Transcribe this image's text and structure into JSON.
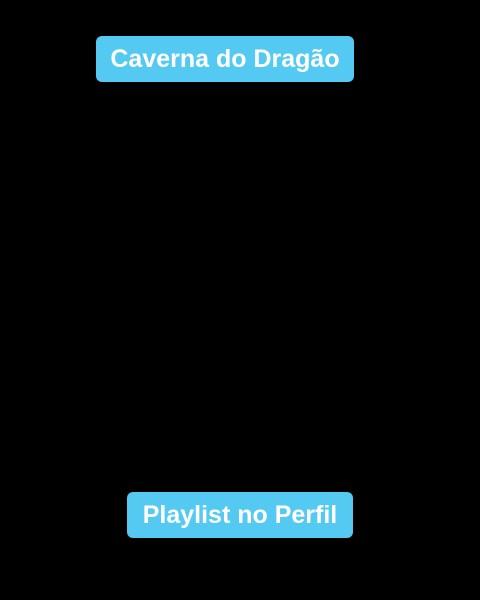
{
  "title_label": "Caverna do Dragão",
  "subtitle_label": "Playlist no Perfil",
  "colors": {
    "background": "#000000",
    "label_background": "#54c9f2",
    "label_text": "#ffffff"
  }
}
